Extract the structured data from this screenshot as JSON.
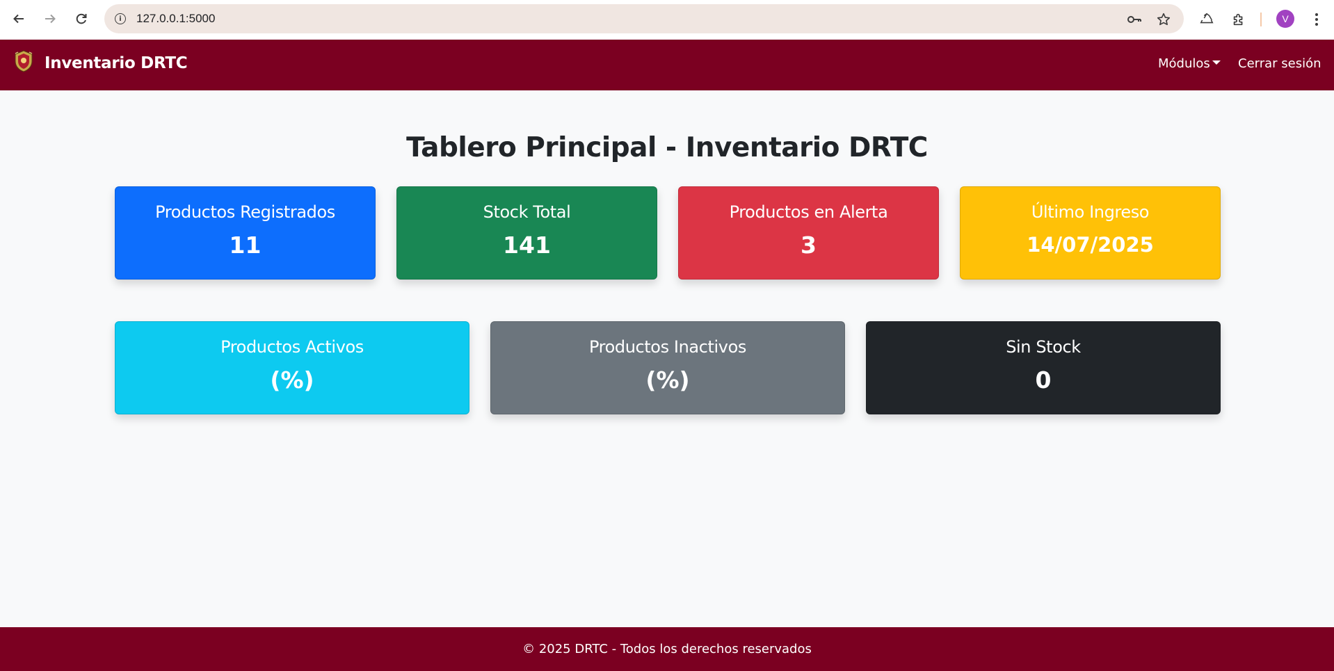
{
  "browser": {
    "url": "127.0.0.1:5000",
    "avatar_letter": "V",
    "icons": [
      "back-arrow-icon",
      "forward-arrow-icon",
      "reload-icon",
      "site-info-icon",
      "password-key-icon",
      "bookmark-star-icon",
      "recycle-icon",
      "extensions-puzzle-icon",
      "kebab-menu-icon"
    ]
  },
  "navbar": {
    "brand": "Inventario DRTC",
    "modules_label": "Módulos",
    "logout_label": "Cerrar sesión",
    "color": "#7b0021"
  },
  "main": {
    "title": "Tablero Principal - Inventario DRTC",
    "cards": [
      {
        "label": "Productos Registrados",
        "value": "11",
        "color": "#0d6efd"
      },
      {
        "label": "Stock Total",
        "value": "141",
        "color": "#198754"
      },
      {
        "label": "Productos en Alerta",
        "value": "3",
        "color": "#dc3545"
      },
      {
        "label": "Último Ingreso",
        "value": "14/07/2025",
        "color": "#ffc107"
      },
      {
        "label": "Productos Activos",
        "value": "(%)",
        "color": "#0dcaf0"
      },
      {
        "label": "Productos Inactivos",
        "value": "(%)",
        "color": "#6c757d"
      },
      {
        "label": "Sin Stock",
        "value": "0",
        "color": "#212529"
      }
    ]
  },
  "footer": {
    "text": "© 2025 DRTC - Todos los derechos reservados"
  }
}
